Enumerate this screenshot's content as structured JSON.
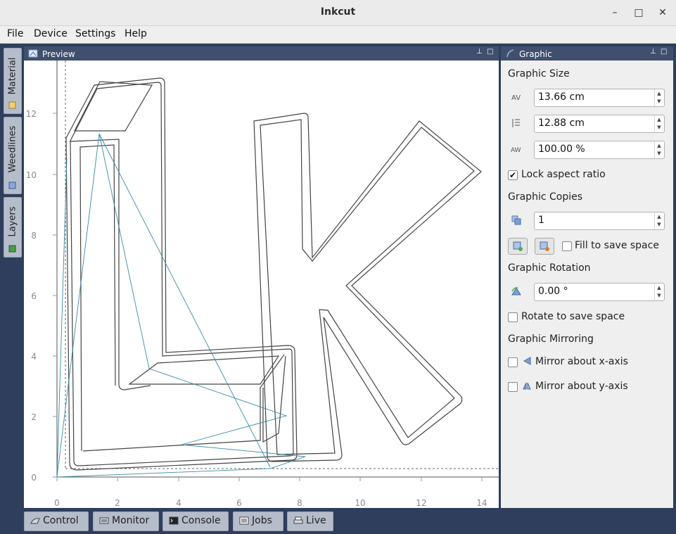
{
  "window": {
    "title": "Inkcut",
    "minimize": "–",
    "maximize": "□",
    "close": "✕"
  },
  "menu": [
    "File",
    "Device",
    "Settings",
    "Help"
  ],
  "left_tabs": [
    {
      "label": "Material",
      "icon": "material-icon"
    },
    {
      "label": "Weedlines",
      "icon": "weedlines-icon"
    },
    {
      "label": "Layers",
      "icon": "layers-icon"
    }
  ],
  "preview": {
    "title": "Preview",
    "x_ticks": [
      "0",
      "2",
      "4",
      "6",
      "8",
      "10",
      "12",
      "14"
    ],
    "y_ticks": [
      "0",
      "2",
      "4",
      "6",
      "8",
      "10",
      "12"
    ]
  },
  "graphic": {
    "title": "Graphic",
    "size_header": "Graphic Size",
    "width": "13.66 cm",
    "height": "12.88 cm",
    "scale": "100.00 %",
    "lock_aspect_label": "Lock aspect ratio",
    "lock_aspect_checked": true,
    "copies_header": "Graphic Copies",
    "copies": "1",
    "fill_label": "Fill to save space",
    "fill_checked": false,
    "rotation_header": "Graphic Rotation",
    "rotation": "0.00 °",
    "rotate_label": "Rotate to save space",
    "rotate_checked": false,
    "mirroring_header": "Graphic Mirroring",
    "mirror_x_label": "Mirror about x-axis",
    "mirror_x_checked": false,
    "mirror_y_label": "Mirror about y-axis",
    "mirror_y_checked": false
  },
  "bottom_tabs": [
    {
      "label": "Control",
      "icon": "control-icon"
    },
    {
      "label": "Monitor",
      "icon": "monitor-icon"
    },
    {
      "label": "Console",
      "icon": "console-icon"
    },
    {
      "label": "Jobs",
      "icon": "jobs-icon"
    },
    {
      "label": "Live",
      "icon": "printer-icon"
    }
  ],
  "colors": {
    "accent_dark": "#2e3e5c",
    "path_stroke": "#444444",
    "travel_line": "#3a8aa8"
  }
}
